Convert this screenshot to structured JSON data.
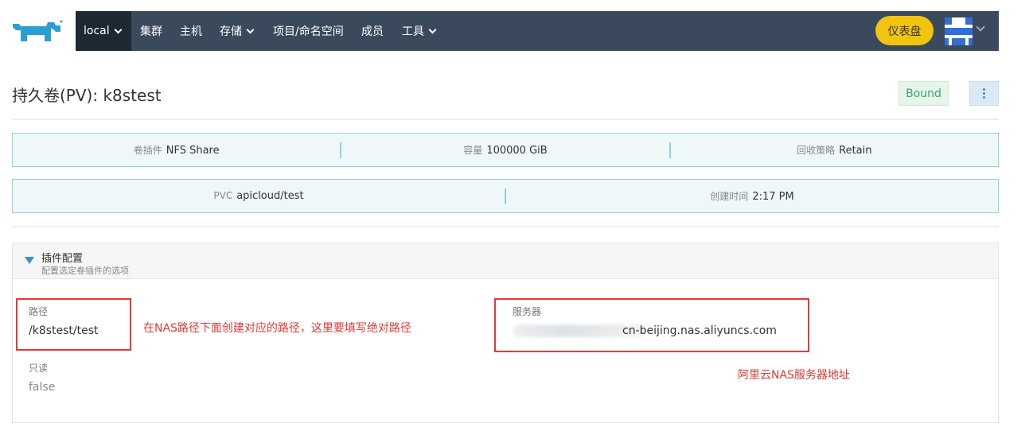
{
  "nav": {
    "cluster": "local",
    "items": [
      {
        "label": "集群",
        "dropdown": false
      },
      {
        "label": "主机",
        "dropdown": false
      },
      {
        "label": "存储",
        "dropdown": true
      },
      {
        "label": "项目/命名空间",
        "dropdown": false
      },
      {
        "label": "成员",
        "dropdown": false
      },
      {
        "label": "工具",
        "dropdown": true
      }
    ],
    "dashboard_label": "仪表盘"
  },
  "header": {
    "title": "持久卷(PV): k8stest",
    "status": "Bound"
  },
  "info_row1": [
    {
      "key": "卷插件",
      "value": "NFS Share"
    },
    {
      "key": "容量",
      "value": "100000 GiB"
    },
    {
      "key": "回收策略",
      "value": "Retain"
    }
  ],
  "info_row2": [
    {
      "key": "PVC",
      "value": "apicloud/test"
    },
    {
      "key": "创建时间",
      "value": "2:17 PM"
    }
  ],
  "panel": {
    "title": "插件配置",
    "subtitle": "配置选定卷插件的选项",
    "path_label": "路径",
    "path_value": "/k8stest/test",
    "readonly_label": "只读",
    "readonly_value": "false",
    "server_label": "服务器",
    "server_value": "cn-beijing.nas.aliyuncs.com"
  },
  "annotations": {
    "path_note": "在NAS路径下面创建对应的路径，这里要填写绝对路径",
    "server_note": "阿里云NAS服务器地址"
  },
  "colors": {
    "nav_bg": "#3a4a5c",
    "cluster_bg": "#1e2833",
    "accent_yellow": "#f1c40f",
    "info_border": "#8fd4db",
    "annotation_red": "#e53935"
  }
}
